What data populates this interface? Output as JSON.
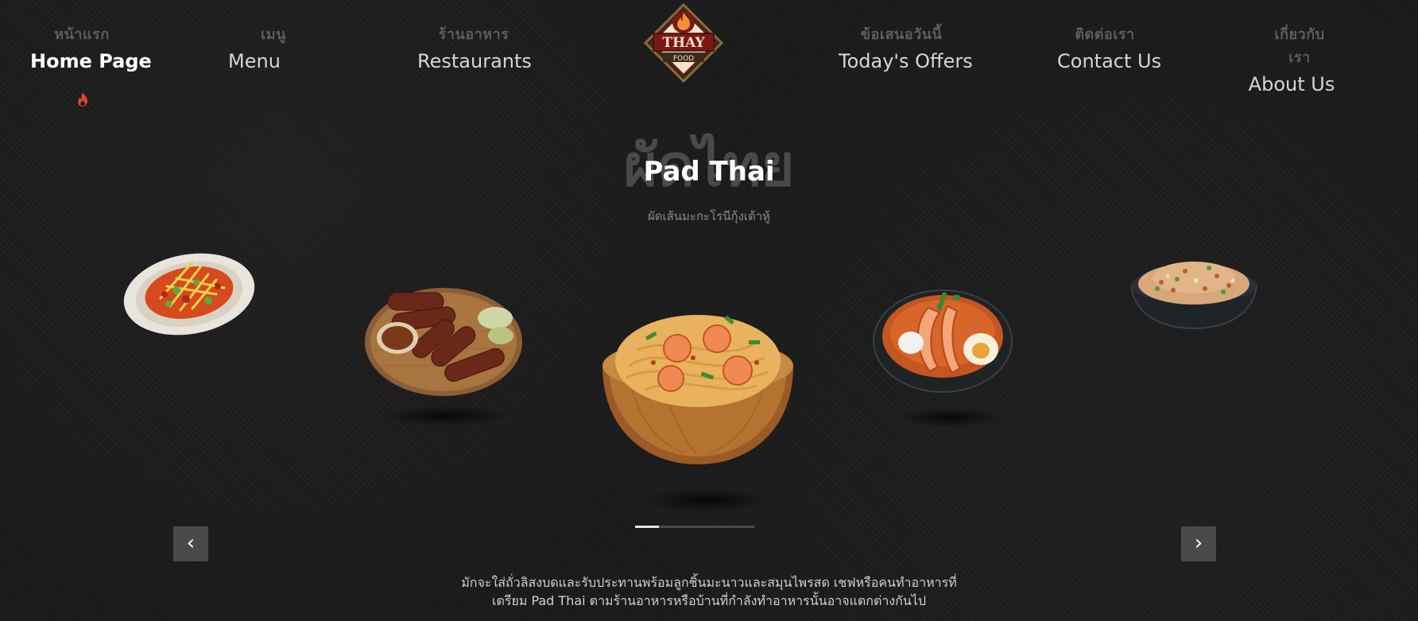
{
  "nav": {
    "items": [
      {
        "thai": "หน้าแรก",
        "label": "Home Page"
      },
      {
        "thai": "เมนู",
        "label": "Menu"
      },
      {
        "thai": "ร้านอาหาร",
        "label": "Restaurants"
      },
      {
        "thai": "ข้อเสนอวันนี้",
        "label": "Today's Offers"
      },
      {
        "thai": "ติดต่อเรา",
        "label": "Contact Us"
      },
      {
        "thai": "เกี่ยวกับเรา",
        "label": "About Us"
      }
    ],
    "active_index": 0,
    "active_icon": "fire-icon"
  },
  "logo": {
    "text": "THAY",
    "subtext": "FOOD"
  },
  "hero": {
    "title_thai": "ผัดไทย",
    "title": "Pad Thai",
    "subtitle": "ผัดเส้นมะกะโรนีกุ้งเต้าหู้"
  },
  "carousel": {
    "dishes": [
      "papaya-salad",
      "grilled-sausage",
      "pad-thai",
      "tom-yum-soup",
      "fried-rice"
    ],
    "active_dish": "pad-thai",
    "progress": 0.2,
    "prev_icon": "chevron-left-icon",
    "next_icon": "chevron-right-icon",
    "prev_glyph": "‹",
    "next_glyph": "›"
  },
  "description": {
    "line1": "มักจะใส่ถั่วลิสงบดและรับประทานพร้อมลูกชิ้นมะนาวและสมุนไพรสด เชฟหรือคนทำอาหารที่",
    "line2": "เตรียม Pad Thai ตามร้านอาหารหรือบ้านที่กำลังทำอาหารนั้นอาจแตกต่างกันไป"
  },
  "colors": {
    "background": "#1b1b1b",
    "accent": "#e0452a",
    "button": "#4a4a4a"
  }
}
